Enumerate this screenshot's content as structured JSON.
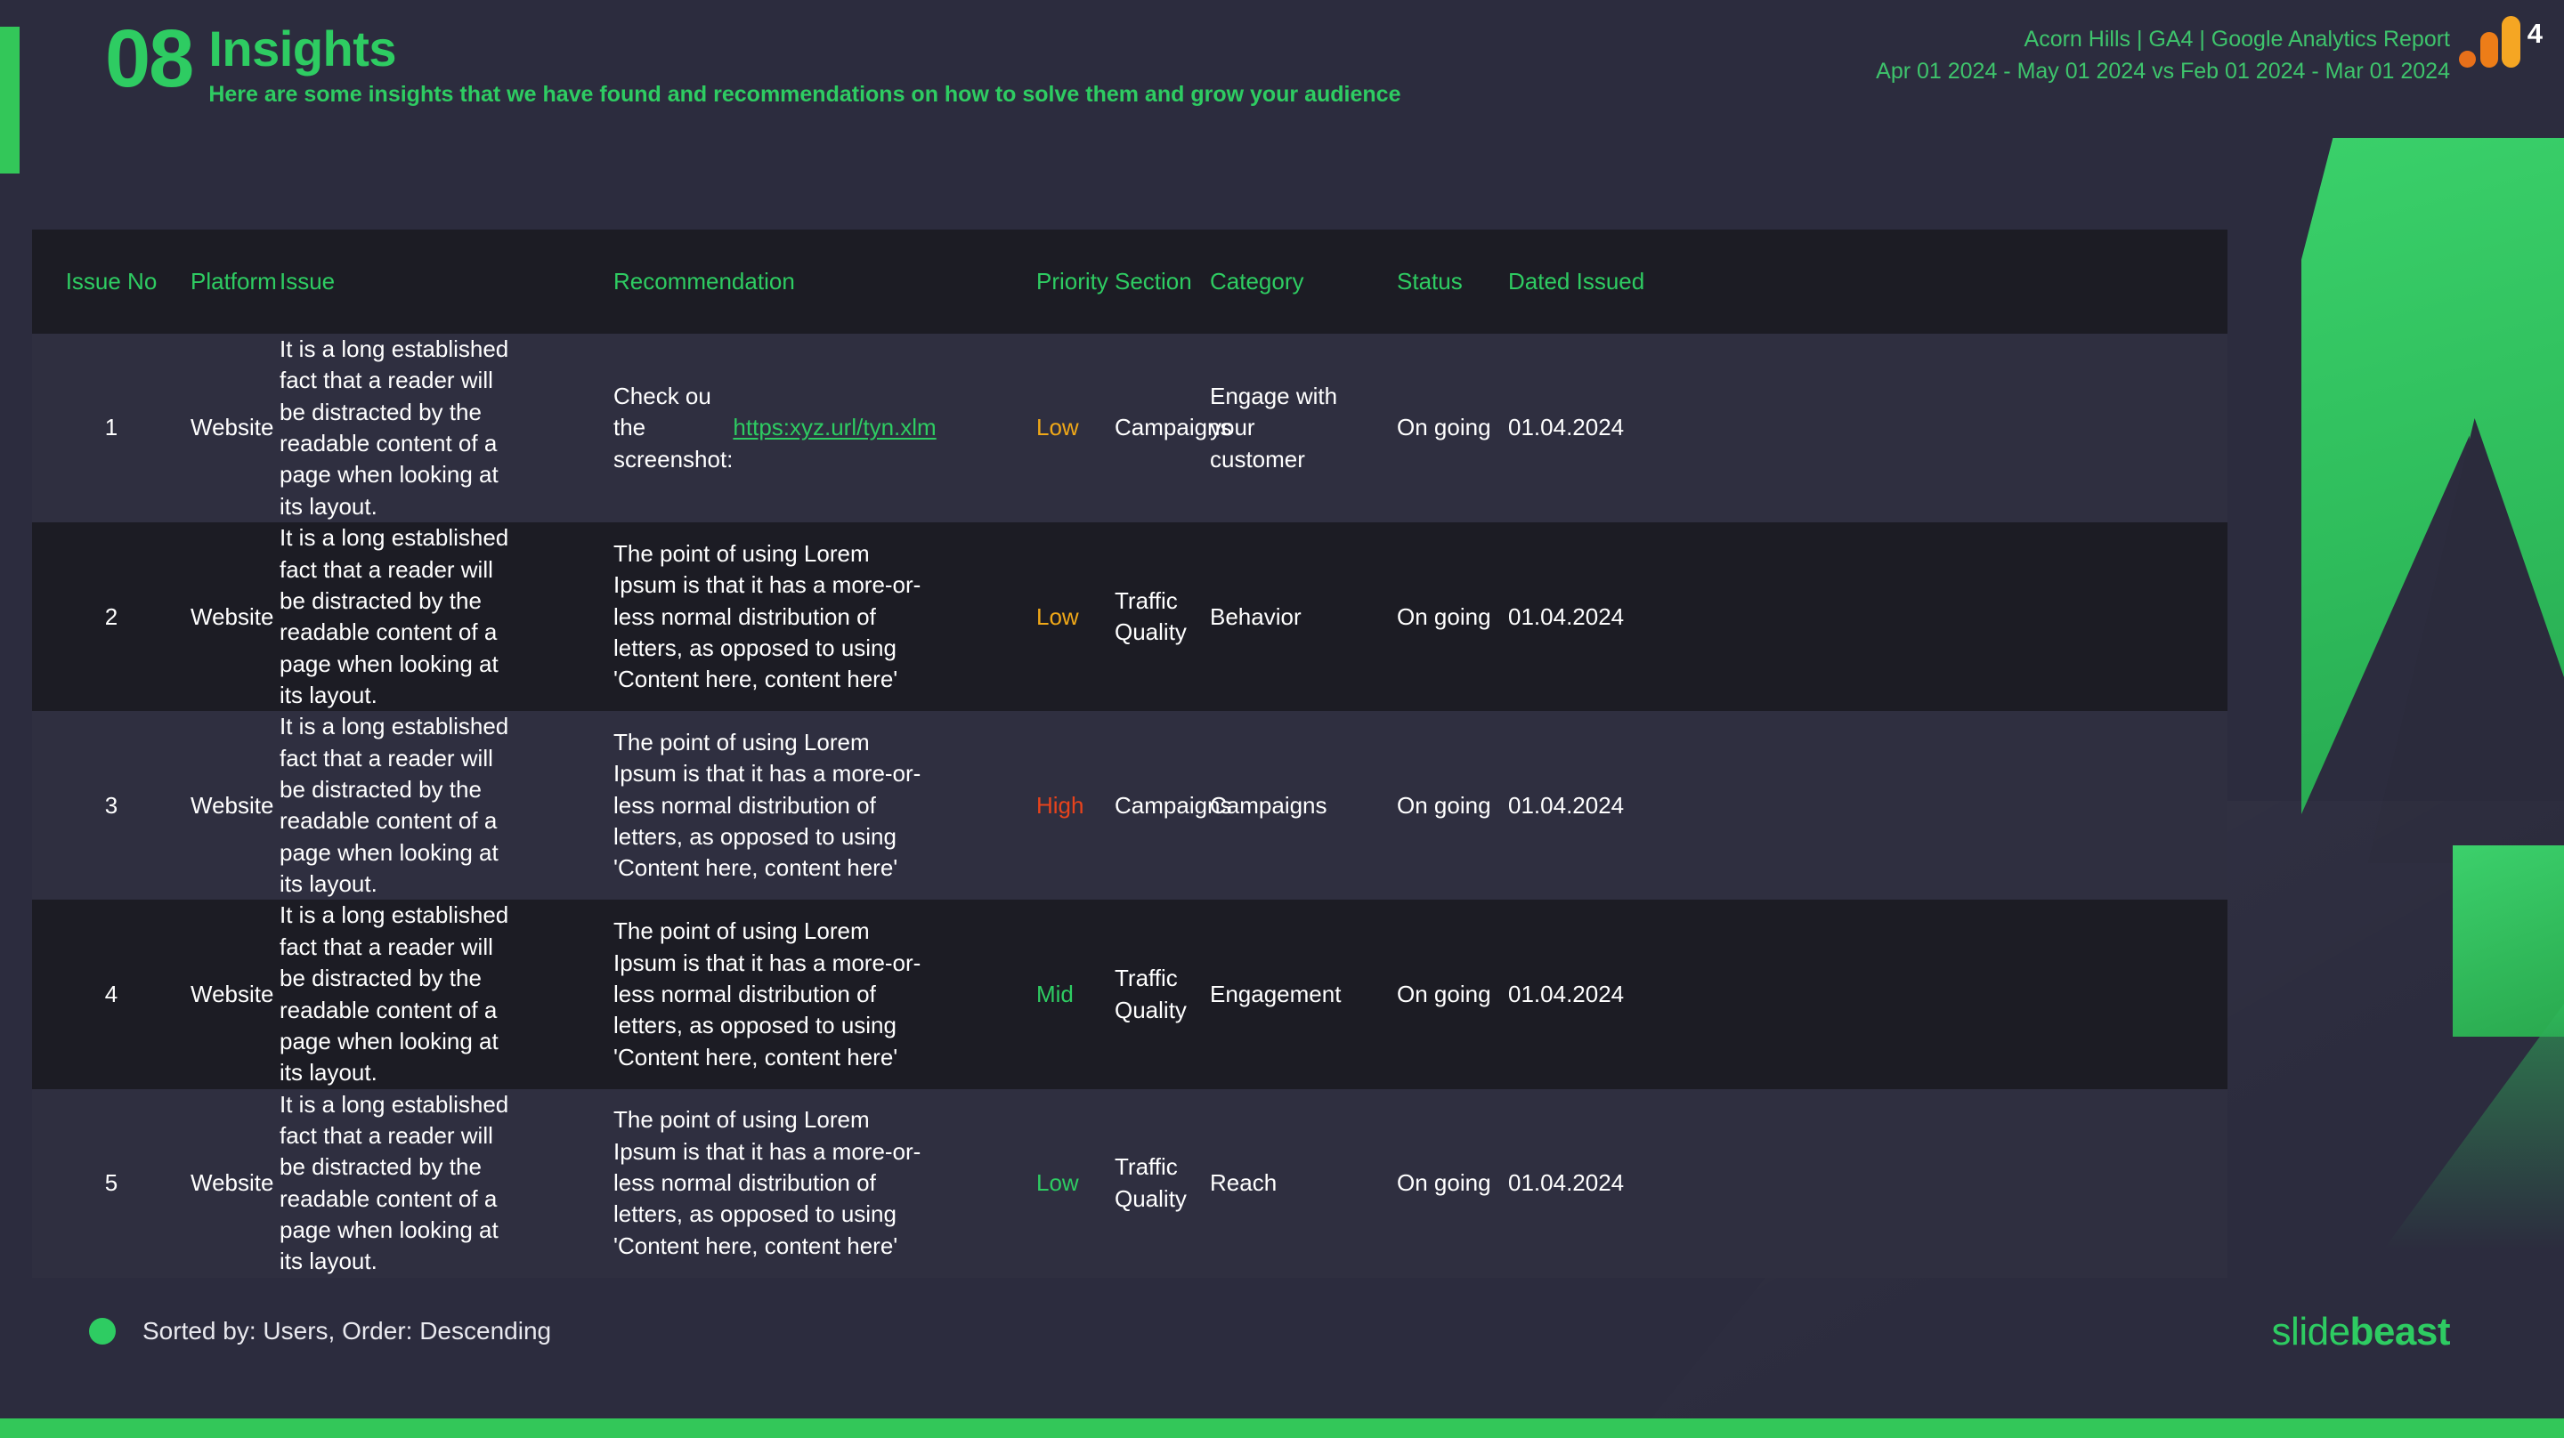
{
  "header": {
    "section_number": "08",
    "title": "Insights",
    "subtitle": "Here are some insights that we have found and recommendations on how to solve them and grow your audience",
    "report_name": "Acorn Hills | GA4 | Google Analytics Report",
    "report_range": "Apr 01 2024 - May 01 2024 vs Feb 01 2024 - Mar 01 2024",
    "ga_badge": "4"
  },
  "table": {
    "columns": [
      "Issue No",
      "Platform",
      "Issue",
      "Recommendation",
      "Priority",
      "Section",
      "Category",
      "Status",
      "Dated Issued"
    ],
    "rows": [
      {
        "no": "1",
        "platform": "Website",
        "issue": "It is a long established fact that a reader will be distracted by the readable content of a page when looking at its layout.",
        "recommendation_prefix": "Check ou the screenshot: ",
        "recommendation_link": "https:xyz.url/tyn.xlm",
        "recommendation": "",
        "priority": "Low",
        "priority_color": "#f0a818",
        "section": "Campaigns",
        "category": "Engage with your customer",
        "status": "On going",
        "date": "01.04.2024"
      },
      {
        "no": "2",
        "platform": "Website",
        "issue": "It is a long established fact that a reader will be distracted by the readable content of a page when looking at its layout.",
        "recommendation_prefix": "",
        "recommendation_link": "",
        "recommendation": "The point of using Lorem Ipsum is that it has a more-or-less normal distribution of letters, as opposed to using 'Content here, content here'",
        "priority": "Low",
        "priority_color": "#f0a818",
        "section": "Traffic Quality",
        "category": "Behavior",
        "status": "On going",
        "date": "01.04.2024"
      },
      {
        "no": "3",
        "platform": "Website",
        "issue": "It is a long established fact that a reader will be distracted by the readable content of a page when looking at its layout.",
        "recommendation_prefix": "",
        "recommendation_link": "",
        "recommendation": "The point of using Lorem Ipsum is that it has a more-or-less normal distribution of letters, as opposed to using 'Content here, content here'",
        "priority": "High",
        "priority_color": "#e8431c",
        "section": "Campaigns",
        "category": "Campaigns",
        "status": "On going",
        "date": "01.04.2024"
      },
      {
        "no": "4",
        "platform": "Website",
        "issue": "It is a long established fact that a reader will be distracted by the readable content of a page when looking at its layout.",
        "recommendation_prefix": "",
        "recommendation_link": "",
        "recommendation": "The point of using Lorem Ipsum is that it has a more-or-less normal distribution of letters, as opposed to using 'Content here, content here'",
        "priority": "Mid",
        "priority_color": "#2ecc62",
        "section": "Traffic Quality",
        "category": "Engagement",
        "status": "On going",
        "date": "01.04.2024"
      },
      {
        "no": "5",
        "platform": "Website",
        "issue": "It is a long established fact that a reader will be distracted by the readable content of a page when looking at its layout.",
        "recommendation_prefix": "",
        "recommendation_link": "",
        "recommendation": "The point of using Lorem Ipsum is that it has a more-or-less normal distribution of letters, as opposed to using 'Content here, content here'",
        "priority": "Low",
        "priority_color": "#2ecc62",
        "section": "Traffic Quality",
        "category": "Reach",
        "status": "On going",
        "date": "01.04.2024"
      }
    ]
  },
  "footer": {
    "sorted_by": "Sorted by: Users, Order: Descending",
    "brand_prefix": "slide",
    "brand_suffix": "beast"
  },
  "colors": {
    "accent_green": "#2ecc62",
    "bg": "#2c2c3e",
    "row_odd": "#2f2f40",
    "row_even": "#1c1c24",
    "header_row": "#1c1c24",
    "priority_low": "#f0a818",
    "priority_high": "#e8431c",
    "priority_mid": "#2ecc62"
  }
}
